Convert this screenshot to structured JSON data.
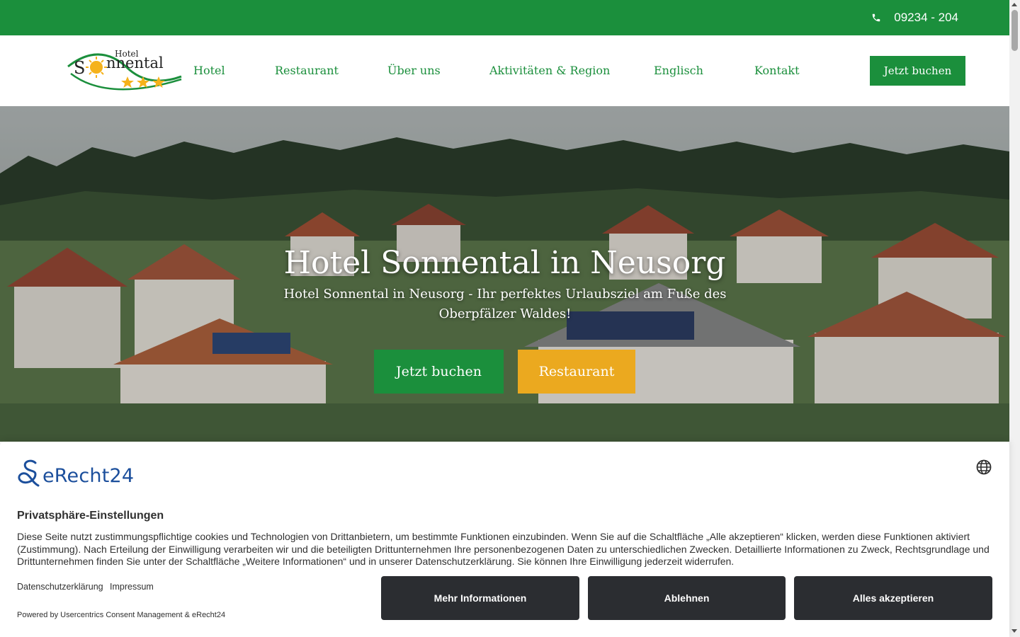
{
  "topbar": {
    "phone_icon": "phone-icon",
    "phone_number": "09234 - 204",
    "background_color": "#1b8f3c"
  },
  "header": {
    "logo": {
      "word_small": "Hotel",
      "word_main": "nnental",
      "initial": "S",
      "stars": 3
    },
    "nav": [
      {
        "label": "Hotel"
      },
      {
        "label": "Restaurant"
      },
      {
        "label": "Über uns"
      },
      {
        "label": "Aktivitäten & Region"
      },
      {
        "label": "Englisch"
      },
      {
        "label": "Kontakt"
      }
    ],
    "cta_label": "Jetzt buchen",
    "accent_color": "#1b8f3c"
  },
  "hero": {
    "title": "Hotel Sonnental in Neusorg",
    "subtitle": "Hotel Sonnental in Neusorg - Ihr perfektes Urlaubsziel am Fuße des Oberpfälzer Waldes!",
    "buttons": [
      {
        "label": "Jetzt buchen",
        "color": "#1b8f3c"
      },
      {
        "label": "Restaurant",
        "color": "#eba91f"
      }
    ]
  },
  "consent": {
    "brand": "eRecht24",
    "language_icon": "globe-icon",
    "title": "Privatsphäre-Einstellungen",
    "body": "Diese Seite nutzt zustimmungspflichtige cookies und Technologien von Drittanbietern, um bestimmte Funktionen einzubinden. Wenn Sie auf die Schaltfläche „Alle akzeptieren“ klicken, werden diese Funktionen aktiviert (Zustimmung). Nach Erteilung der Einwilligung verarbeiten wir und die beteiligten Drittunternehmen Ihre personenbezogenen Daten zu unterschiedlichen Zwecken. Detaillierte Informationen zu Zweck, Rechtsgrundlage und Drittunternehmen finden Sie unter der Schaltfläche „Weitere Informationen“ und in unserer Datenschutzerklärung. Sie können Ihre Einwilligung jederzeit widerrufen.",
    "links": [
      {
        "label": "Datenschutzerklärung"
      },
      {
        "label": "Impressum"
      }
    ],
    "powered_by": "Powered by Usercentrics Consent Management & eRecht24",
    "buttons": [
      {
        "label": "Mehr Informationen"
      },
      {
        "label": "Ablehnen"
      },
      {
        "label": "Alles akzeptieren"
      }
    ],
    "button_color": "#2b2d31"
  }
}
